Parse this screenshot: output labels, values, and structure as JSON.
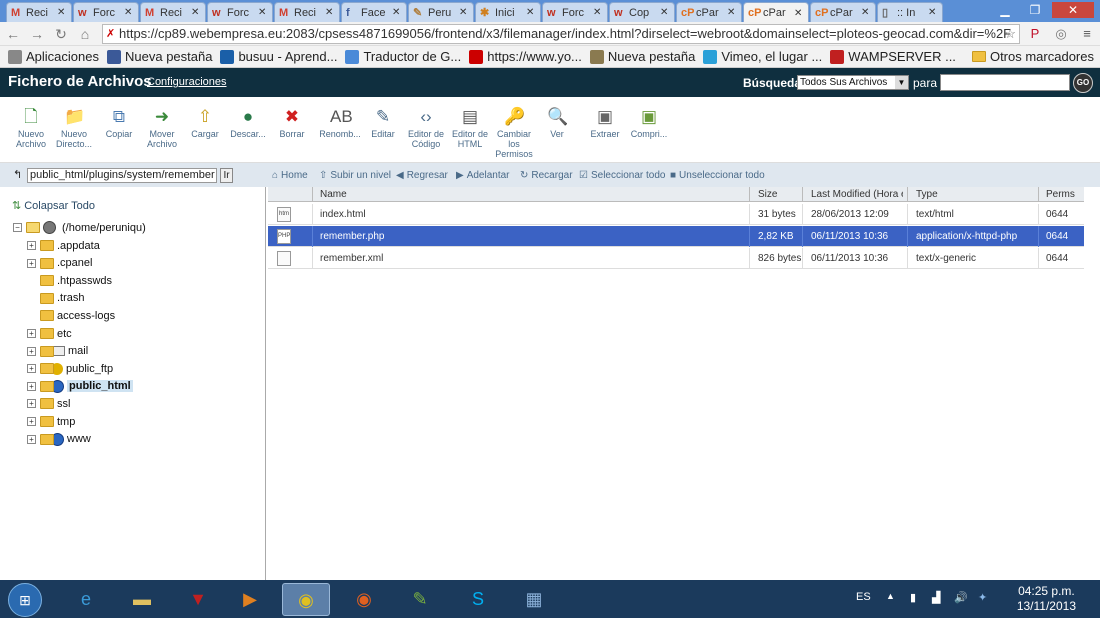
{
  "browser": {
    "tabs": [
      {
        "icon": "gmail-icon",
        "label": "Reci",
        "color": "#d04030",
        "glyph": "M"
      },
      {
        "icon": "forum-icon",
        "label": "Forc",
        "color": "#c03020",
        "glyph": "w"
      },
      {
        "icon": "gmail-icon",
        "label": "Reci",
        "color": "#d04030",
        "glyph": "M"
      },
      {
        "icon": "forum-icon",
        "label": "Forc",
        "color": "#c03020",
        "glyph": "w"
      },
      {
        "icon": "gmail-icon",
        "label": "Reci",
        "color": "#d04030",
        "glyph": "M"
      },
      {
        "icon": "facebook-icon",
        "label": "Face",
        "color": "#3b5998",
        "glyph": "f"
      },
      {
        "icon": "doc-icon",
        "label": "Peru",
        "color": "#b08040",
        "glyph": "✎"
      },
      {
        "icon": "joomla-icon",
        "label": "Inici",
        "color": "#d08020",
        "glyph": "✱"
      },
      {
        "icon": "forum-icon",
        "label": "Forc",
        "color": "#c03020",
        "glyph": "w"
      },
      {
        "icon": "forum-icon",
        "label": "Cop",
        "color": "#c03020",
        "glyph": "w"
      },
      {
        "icon": "cpanel-icon",
        "label": "cPar",
        "color": "#e07020",
        "glyph": "cP"
      },
      {
        "icon": "cpanel-icon",
        "label": "cPar",
        "color": "#e07020",
        "glyph": "cP",
        "active": true
      },
      {
        "icon": "cpanel-icon",
        "label": "cPar",
        "color": "#e07020",
        "glyph": "cP"
      },
      {
        "icon": "page-icon",
        "label": ":: In",
        "color": "#666666",
        "glyph": "▯"
      }
    ],
    "url": "https://cp89.webempresa.eu:2083/cpsess4871699056/frontend/x3/filemanager/index.html?dirselect=webroot&domainselect=ploteos-geocad.com&dir=%2F",
    "bookmarks": [
      {
        "label": "Aplicaciones",
        "icon": "apps-icon",
        "color": "#888888"
      },
      {
        "label": "Nueva pestaña",
        "icon": "facebook-icon",
        "color": "#3b5998"
      },
      {
        "label": "busuu - Aprend...",
        "icon": "busuu-icon",
        "color": "#1a5fa8"
      },
      {
        "label": "Traductor de G...",
        "icon": "translate-icon",
        "color": "#4a8ad8"
      },
      {
        "label": "https://www.yo...",
        "icon": "youtube-icon",
        "color": "#cc0000"
      },
      {
        "label": "Nueva pestaña",
        "icon": "eye-icon",
        "color": "#8a7a50"
      },
      {
        "label": "Vimeo, el lugar ...",
        "icon": "vimeo-icon",
        "color": "#2aa0d8"
      },
      {
        "label": "WAMPSERVER ...",
        "icon": "wamp-icon",
        "color": "#c02020"
      }
    ],
    "other_bookmarks": "Otros marcadores"
  },
  "cpanel": {
    "title": "Fichero de Archivos",
    "config_link": "Configuraciones",
    "search_label": "Búsqueda",
    "search_scope": "Todos Sus Archivos",
    "para_label": "para",
    "search_value": "",
    "go_label": "GO"
  },
  "toolbar": [
    {
      "label": "Nuevo Archivo",
      "icon": "new-file-icon",
      "glyph": "🗋",
      "color": "#3a8a3a"
    },
    {
      "label": "Nuevo Directo...",
      "icon": "new-folder-icon",
      "glyph": "📁",
      "color": "#c8a020"
    },
    {
      "label": "Copiar",
      "icon": "copy-icon",
      "glyph": "⧉",
      "color": "#4a7ab0"
    },
    {
      "label": "Mover Archivo",
      "icon": "move-icon",
      "glyph": "➜",
      "color": "#3a8a3a"
    },
    {
      "label": "Cargar",
      "icon": "upload-icon",
      "glyph": "⇧",
      "color": "#c8a020"
    },
    {
      "label": "Descar...",
      "icon": "download-icon",
      "glyph": "●",
      "color": "#2a7a4a"
    },
    {
      "label": "Borrar",
      "icon": "delete-icon",
      "glyph": "✖",
      "color": "#d02020"
    },
    {
      "label": "Renomb...",
      "icon": "rename-icon",
      "glyph": "AB",
      "color": "#555555"
    },
    {
      "label": "Editar",
      "icon": "edit-icon",
      "glyph": "✎",
      "color": "#4a6a88"
    },
    {
      "label": "Editor de Código",
      "icon": "code-editor-icon",
      "glyph": "‹›",
      "color": "#4a6a88"
    },
    {
      "label": "Editor de HTML",
      "icon": "html-editor-icon",
      "glyph": "▤",
      "color": "#555555"
    },
    {
      "label": "Cambiar los Permisos",
      "icon": "permissions-icon",
      "glyph": "🔑",
      "color": "#c8a020"
    },
    {
      "label": "Ver",
      "icon": "view-icon",
      "glyph": "🔍",
      "color": "#4a6a88"
    },
    {
      "label": "Extraer",
      "icon": "extract-icon",
      "glyph": "▣",
      "color": "#666666"
    },
    {
      "label": "Compri...",
      "icon": "compress-icon",
      "glyph": "▣",
      "color": "#6a9a3a"
    }
  ],
  "path": {
    "value": "public_html/plugins/system/remember",
    "go_label": "Ir"
  },
  "tree": {
    "collapse_all": "Colapsar Todo",
    "root": "(/home/peruniqu)",
    "nodes": [
      {
        "label": ".appdata",
        "expandable": true,
        "type": "folder"
      },
      {
        "label": ".cpanel",
        "expandable": true,
        "type": "folder"
      },
      {
        "label": ".htpasswds",
        "expandable": false,
        "type": "folder"
      },
      {
        "label": ".trash",
        "expandable": false,
        "type": "folder"
      },
      {
        "label": "access-logs",
        "expandable": false,
        "type": "folder"
      },
      {
        "label": "etc",
        "expandable": true,
        "type": "folder"
      },
      {
        "label": "mail",
        "expandable": true,
        "type": "mail"
      },
      {
        "label": "public_ftp",
        "expandable": true,
        "type": "ftp"
      },
      {
        "label": "public_html",
        "expandable": true,
        "type": "globe",
        "selected": true
      },
      {
        "label": "ssl",
        "expandable": true,
        "type": "folder"
      },
      {
        "label": "tmp",
        "expandable": true,
        "type": "folder"
      },
      {
        "label": "www",
        "expandable": true,
        "type": "globe"
      }
    ]
  },
  "actions": [
    {
      "label": "Home",
      "icon": "home-icon",
      "glyph": "⌂"
    },
    {
      "label": "Subir un nivel",
      "icon": "up-level-icon",
      "glyph": "⇧"
    },
    {
      "label": "Regresar",
      "icon": "back-icon",
      "glyph": "◀"
    },
    {
      "label": "Adelantar",
      "icon": "forward-icon",
      "glyph": "▶"
    },
    {
      "label": "Recargar",
      "icon": "reload-icon",
      "glyph": "↻"
    },
    {
      "label": "Seleccionar todo",
      "icon": "select-all-icon",
      "glyph": "☑"
    },
    {
      "label": "Unseleccionar todo",
      "icon": "unselect-all-icon",
      "glyph": "■"
    }
  ],
  "table": {
    "columns": [
      "Name",
      "Size",
      "Last Modified (Hora est. I",
      "Type",
      "Perms"
    ],
    "rows": [
      {
        "icon": "html-file-icon",
        "glyph": "htm",
        "name": "index.html",
        "size": "31 bytes",
        "modified": "28/06/2013 12:09",
        "type": "text/html",
        "perms": "0644",
        "selected": false
      },
      {
        "icon": "php-file-icon",
        "glyph": "PHP",
        "name": "remember.php",
        "size": "2,82 KB",
        "modified": "06/11/2013 10:36",
        "type": "application/x-httpd-php",
        "perms": "0644",
        "selected": true
      },
      {
        "icon": "xml-file-icon",
        "glyph": "",
        "name": "remember.xml",
        "size": "826 bytes",
        "modified": "06/11/2013 10:36",
        "type": "text/x-generic",
        "perms": "0644",
        "selected": false
      }
    ]
  },
  "taskbar": {
    "apps": [
      {
        "icon": "ie-icon",
        "glyph": "e",
        "color": "#3a9ad8"
      },
      {
        "icon": "explorer-icon",
        "glyph": "▬",
        "color": "#e0c060"
      },
      {
        "icon": "filezilla-icon",
        "glyph": "▼",
        "color": "#c02020"
      },
      {
        "icon": "media-icon",
        "glyph": "▶",
        "color": "#e08020"
      },
      {
        "icon": "chrome-icon",
        "glyph": "◉",
        "color": "#e0c020",
        "active": true
      },
      {
        "icon": "firefox-icon",
        "glyph": "◉",
        "color": "#e06020"
      },
      {
        "icon": "notepadpp-icon",
        "glyph": "✎",
        "color": "#7ab040"
      },
      {
        "icon": "skype-icon",
        "glyph": "S",
        "color": "#00aff0"
      },
      {
        "icon": "calculator-icon",
        "glyph": "▦",
        "color": "#8ab0d8"
      }
    ],
    "language": "ES",
    "time": "04:25 p.m.",
    "date": "13/11/2013"
  }
}
